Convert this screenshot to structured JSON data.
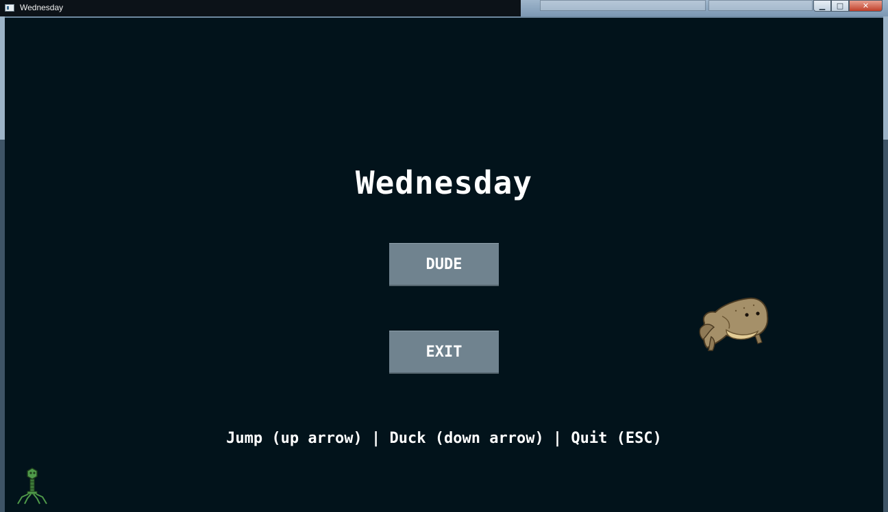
{
  "window": {
    "title": "Wednesday",
    "controls": {
      "minimize": "▁",
      "maximize": "□",
      "close": "✕"
    }
  },
  "game": {
    "title": "Wednesday",
    "menu": [
      {
        "label": "DUDE"
      },
      {
        "label": "EXIT"
      }
    ],
    "controls_hint": "Jump (up arrow) | Duck (down arrow) | Quit (ESC)",
    "sprites": [
      "frog-sprite",
      "phage-sprite"
    ]
  },
  "colors": {
    "background": "#02131b",
    "button": "#70838f",
    "text": "#ffffff"
  }
}
